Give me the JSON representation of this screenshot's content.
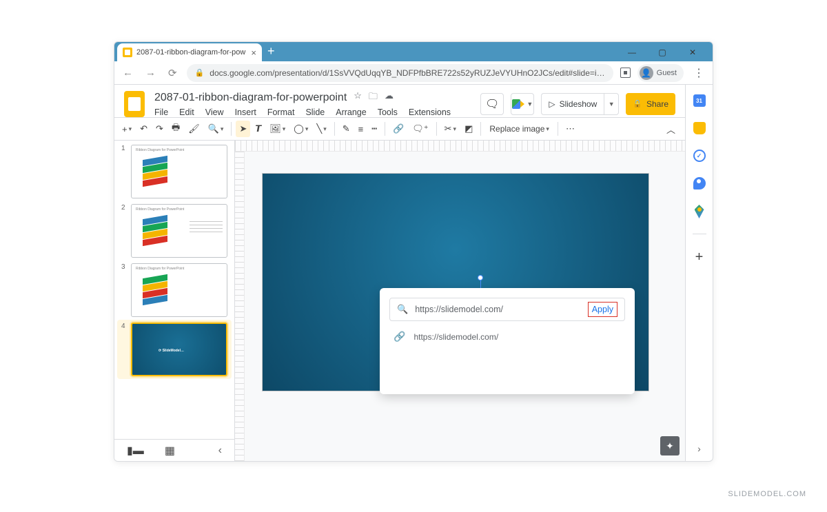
{
  "browser": {
    "tab_title": "2087-01-ribbon-diagram-for-pow",
    "url": "docs.google.com/presentation/d/1SsVVQdUqqYB_NDFPfbBRE722s52yRUZJeVYUHnO2JCs/edit#slide=id.g1c…",
    "guest_label": "Guest"
  },
  "doc": {
    "title": "2087-01-ribbon-diagram-for-powerpoint",
    "thumb_caption": "Ribbon Diagram for PowerPoint"
  },
  "menus": [
    "File",
    "Edit",
    "View",
    "Insert",
    "Format",
    "Slide",
    "Arrange",
    "Tools",
    "Extensions"
  ],
  "header": {
    "slideshow": "Slideshow",
    "share": "Share"
  },
  "toolbar": {
    "replace_image": "Replace image"
  },
  "thumbs": [
    {
      "num": "1"
    },
    {
      "num": "2"
    },
    {
      "num": "3"
    },
    {
      "num": "4"
    }
  ],
  "slide_logo": {
    "brand_a": "Slide",
    "brand_b": "Model",
    "suffix": ".com"
  },
  "link_popover": {
    "input_value": "https://slidemodel.com/",
    "apply": "Apply",
    "suggestion": "https://slidemodel.com/"
  },
  "watermark": "SLIDEMODEL.COM"
}
